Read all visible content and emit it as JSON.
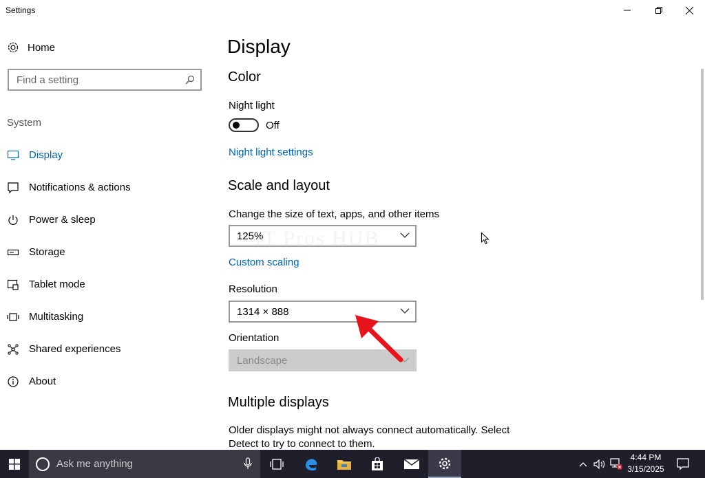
{
  "window": {
    "title": "Settings"
  },
  "sidebar": {
    "home_label": "Home",
    "search_placeholder": "Find a setting",
    "section_label": "System",
    "items": [
      {
        "label": "Display",
        "icon": "monitor-icon",
        "active": true
      },
      {
        "label": "Notifications & actions",
        "icon": "message-icon"
      },
      {
        "label": "Power & sleep",
        "icon": "power-icon"
      },
      {
        "label": "Storage",
        "icon": "storage-icon"
      },
      {
        "label": "Tablet mode",
        "icon": "tablet-icon"
      },
      {
        "label": "Multitasking",
        "icon": "multitask-icon"
      },
      {
        "label": "Shared experiences",
        "icon": "share-icon"
      },
      {
        "label": "About",
        "icon": "info-icon"
      }
    ]
  },
  "main": {
    "page_title": "Display",
    "color": {
      "heading": "Color",
      "night_light_label": "Night light",
      "night_light_state": "Off",
      "night_light_settings_link": "Night light settings"
    },
    "scale": {
      "heading": "Scale and layout",
      "size_label": "Change the size of text, apps, and other items",
      "size_value": "125%",
      "custom_scaling_link": "Custom scaling",
      "resolution_label": "Resolution",
      "resolution_value": "1314 × 888",
      "orientation_label": "Orientation",
      "orientation_value": "Landscape"
    },
    "multiple": {
      "heading": "Multiple displays",
      "description": "Older displays might not always connect automatically. Select Detect to try to connect to them."
    }
  },
  "watermark": "IT Pros HUB",
  "taskbar": {
    "search_text": "Ask me anything",
    "time": "4:44 PM",
    "date": "3/15/2025"
  },
  "colors": {
    "accent": "#0063b1",
    "taskbar": "#1f1f2b",
    "annotation_arrow": "#e8141c"
  }
}
